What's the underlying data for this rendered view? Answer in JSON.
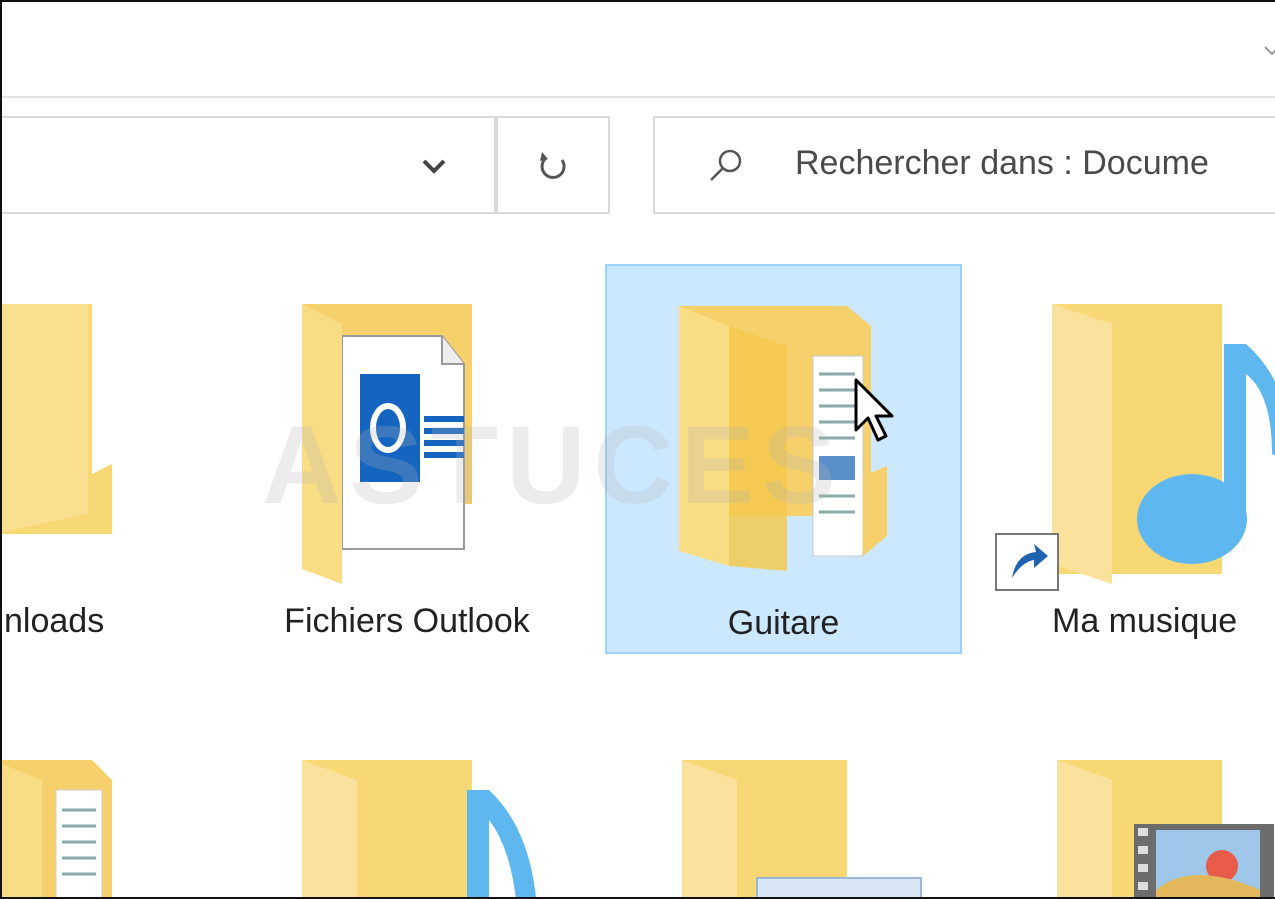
{
  "search": {
    "placeholder": "Rechercher dans : Docume"
  },
  "toolbar": {
    "address_dropdown_icon": "chevron-down-icon",
    "refresh_icon": "refresh-icon",
    "search_icon": "search-icon"
  },
  "items": [
    {
      "label": "nloads",
      "icon": "folder-icon"
    },
    {
      "label": "Fichiers Outlook",
      "icon": "outlook-folder-icon"
    },
    {
      "label": "Guitare",
      "icon": "folder-document-icon",
      "selected": true
    },
    {
      "label": "Ma musique",
      "icon": "music-folder-shortcut-icon"
    }
  ],
  "watermark": "ASTUCES",
  "colors": {
    "selection_bg": "#cce8ff",
    "selection_border": "#99d1ff",
    "folder": "#f8d775"
  }
}
